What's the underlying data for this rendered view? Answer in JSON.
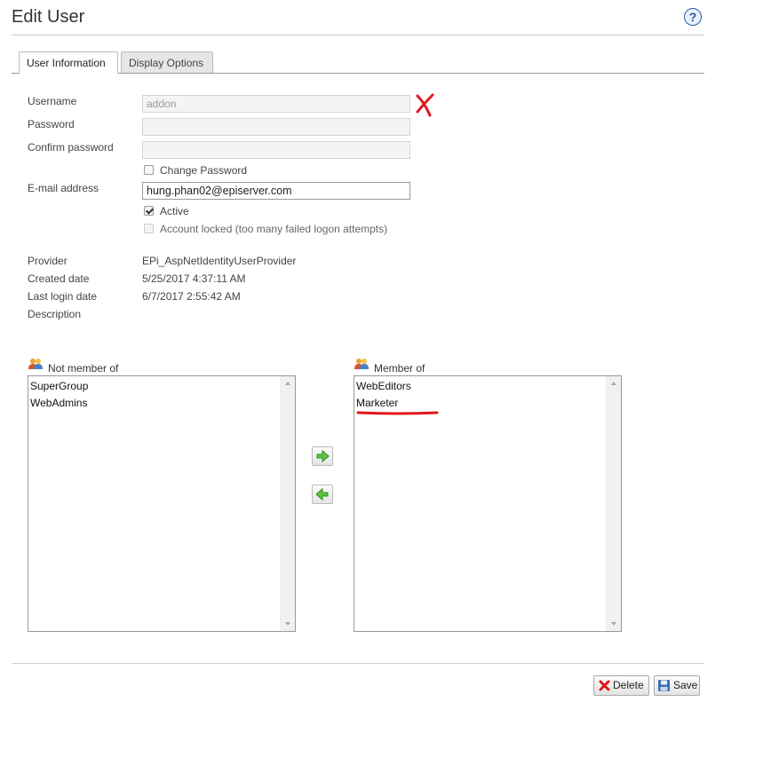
{
  "page": {
    "title": "Edit User",
    "help_icon": "?"
  },
  "tabs": [
    {
      "label": "User Information",
      "active": true
    },
    {
      "label": "Display Options",
      "active": false
    }
  ],
  "form": {
    "username": {
      "label": "Username",
      "value": "addon",
      "disabled": true
    },
    "password": {
      "label": "Password",
      "value": ""
    },
    "confirm_password": {
      "label": "Confirm password",
      "value": ""
    },
    "change_password": {
      "label": "Change Password",
      "checked": false
    },
    "email": {
      "label": "E-mail address",
      "value": "hung.phan02@episerver.com"
    },
    "active": {
      "label": "Active",
      "checked": true
    },
    "account_locked": {
      "label": "Account locked (too many failed logon attempts)",
      "checked": false,
      "disabled": true
    }
  },
  "info": {
    "provider": {
      "label": "Provider",
      "value": "EPi_AspNetIdentityUserProvider"
    },
    "created": {
      "label": "Created date",
      "value": "5/25/2017 4:37:11 AM"
    },
    "last_login": {
      "label": "Last login date",
      "value": "6/7/2017 2:55:42 AM"
    },
    "description": {
      "label": "Description",
      "value": ""
    }
  },
  "groups": {
    "not_member": {
      "label": "Not member of",
      "items": [
        "SuperGroup",
        "WebAdmins"
      ]
    },
    "member": {
      "label": "Member of",
      "items": [
        "WebEditors",
        "Marketer"
      ]
    }
  },
  "buttons": {
    "delete": "Delete",
    "save": "Save"
  },
  "annotations": {
    "cross_color": "#e0151d",
    "underline_color": "#e0151d"
  },
  "icons": [
    "help-icon",
    "group-icon",
    "arrow-right-icon",
    "arrow-left-icon",
    "delete-icon",
    "save-icon"
  ]
}
